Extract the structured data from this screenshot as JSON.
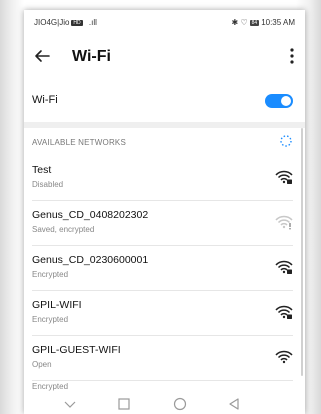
{
  "status_bar": {
    "carrier": "JIO4G|Jio",
    "carrier_badge": "HD",
    "signal_text": ".ıll",
    "icons_text": "✱ ♡",
    "battery": "84",
    "time": "10:35 AM"
  },
  "header": {
    "title": "Wi-Fi"
  },
  "wifi_toggle": {
    "label": "Wi-Fi",
    "enabled": true,
    "accent": "#1a8cff"
  },
  "available": {
    "title": "AVAILABLE NETWORKS",
    "networks": [
      {
        "name": "Test",
        "status": "Disabled",
        "icon": "wifi-locked-icon",
        "signal": "full"
      },
      {
        "name": "Genus_CD_0408202302",
        "status": "Saved, encrypted",
        "icon": "wifi-weak-icon",
        "signal": "weak"
      },
      {
        "name": "Genus_CD_0230600001",
        "status": "Encrypted",
        "icon": "wifi-locked-icon",
        "signal": "full"
      },
      {
        "name": "GPIL-WIFI",
        "status": "Encrypted",
        "icon": "wifi-locked-icon",
        "signal": "full"
      },
      {
        "name": "GPIL-GUEST-WIFI",
        "status": "Open",
        "icon": "wifi-open-icon",
        "signal": "full"
      }
    ],
    "partial_status": "Encrypted"
  },
  "nav": {
    "icons": [
      "chevron-down-icon",
      "square-icon",
      "circle-icon",
      "triangle-back-icon"
    ]
  }
}
